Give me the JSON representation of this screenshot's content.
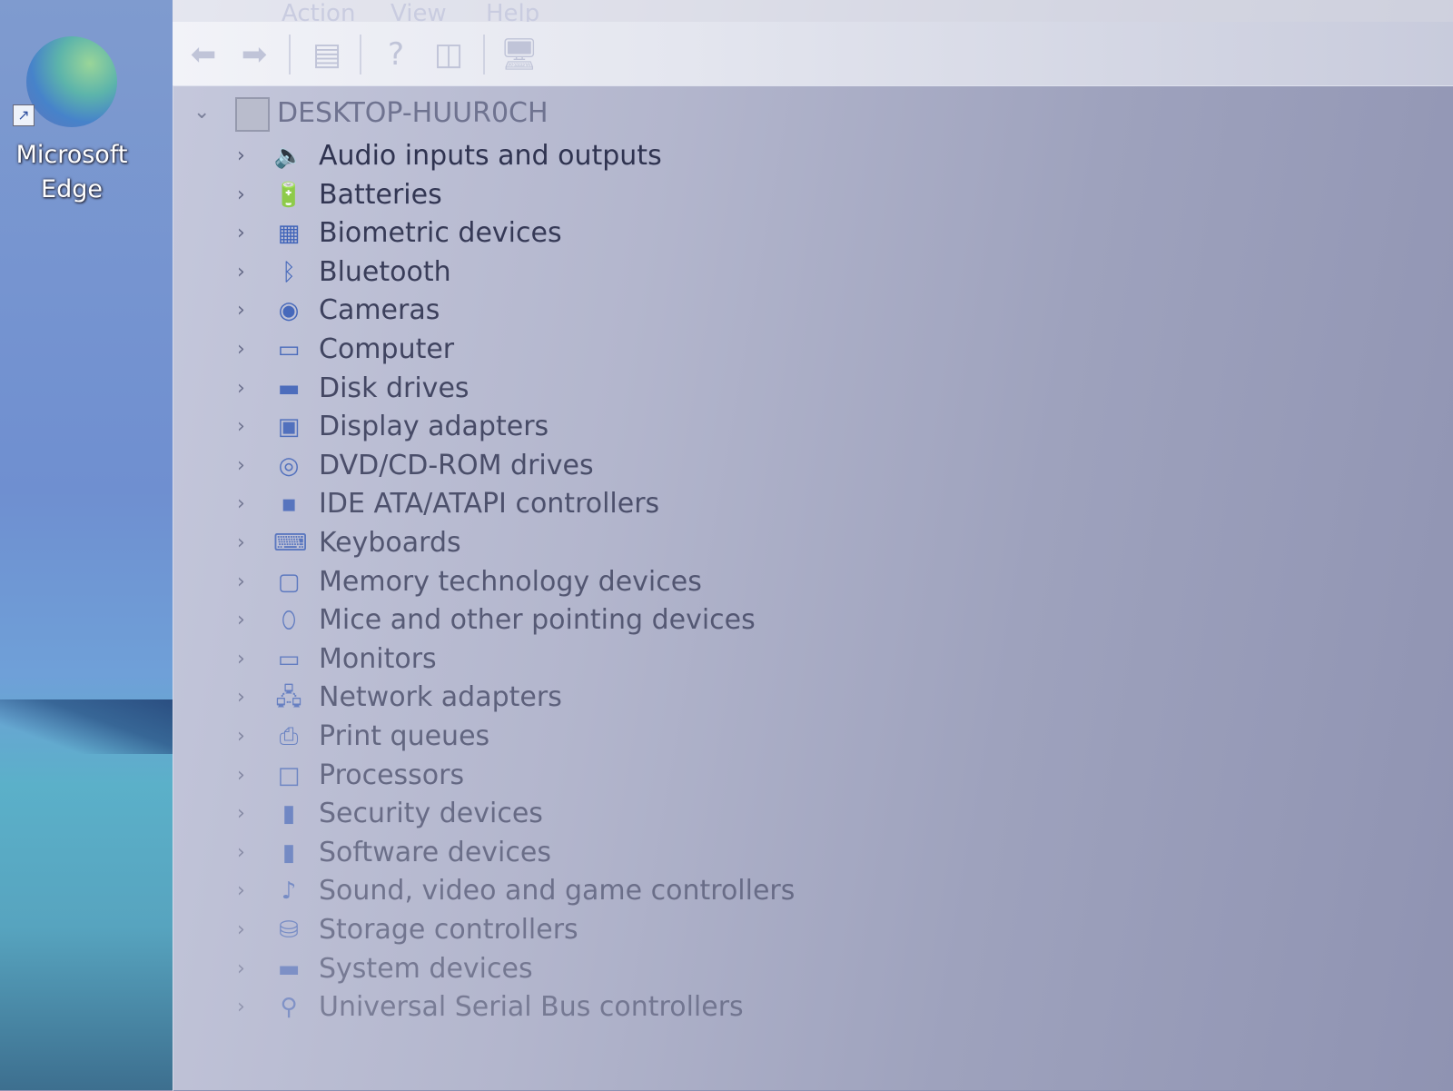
{
  "desktop": {
    "shortcut_label_line1": "Microsoft",
    "shortcut_label_line2": "Edge"
  },
  "menubar": {
    "items": [
      "Action",
      "View",
      "Help"
    ]
  },
  "toolbar": {
    "back": "back-arrow-icon",
    "forward": "forward-arrow-icon"
  },
  "tree": {
    "root_label": "DESKTOP-HUUR0CH",
    "categories": [
      {
        "label": "Audio inputs and outputs",
        "icon": "speaker-icon"
      },
      {
        "label": "Batteries",
        "icon": "battery-icon"
      },
      {
        "label": "Biometric devices",
        "icon": "fingerprint-icon"
      },
      {
        "label": "Bluetooth",
        "icon": "bluetooth-icon"
      },
      {
        "label": "Cameras",
        "icon": "camera-icon"
      },
      {
        "label": "Computer",
        "icon": "computer-icon"
      },
      {
        "label": "Disk drives",
        "icon": "disk-drive-icon"
      },
      {
        "label": "Display adapters",
        "icon": "display-adapter-icon"
      },
      {
        "label": "DVD/CD-ROM drives",
        "icon": "dvd-drive-icon"
      },
      {
        "label": "IDE ATA/ATAPI controllers",
        "icon": "ide-controller-icon"
      },
      {
        "label": "Keyboards",
        "icon": "keyboard-icon"
      },
      {
        "label": "Memory technology devices",
        "icon": "memory-device-icon"
      },
      {
        "label": "Mice and other pointing devices",
        "icon": "mouse-icon"
      },
      {
        "label": "Monitors",
        "icon": "monitor-icon"
      },
      {
        "label": "Network adapters",
        "icon": "network-adapter-icon"
      },
      {
        "label": "Print queues",
        "icon": "printer-icon"
      },
      {
        "label": "Processors",
        "icon": "processor-icon"
      },
      {
        "label": "Security devices",
        "icon": "security-device-icon"
      },
      {
        "label": "Software devices",
        "icon": "software-device-icon"
      },
      {
        "label": "Sound, video and game controllers",
        "icon": "sound-controller-icon"
      },
      {
        "label": "Storage controllers",
        "icon": "storage-controller-icon"
      },
      {
        "label": "System devices",
        "icon": "system-folder-icon"
      },
      {
        "label": "Universal Serial Bus controllers",
        "icon": "usb-icon"
      }
    ]
  }
}
